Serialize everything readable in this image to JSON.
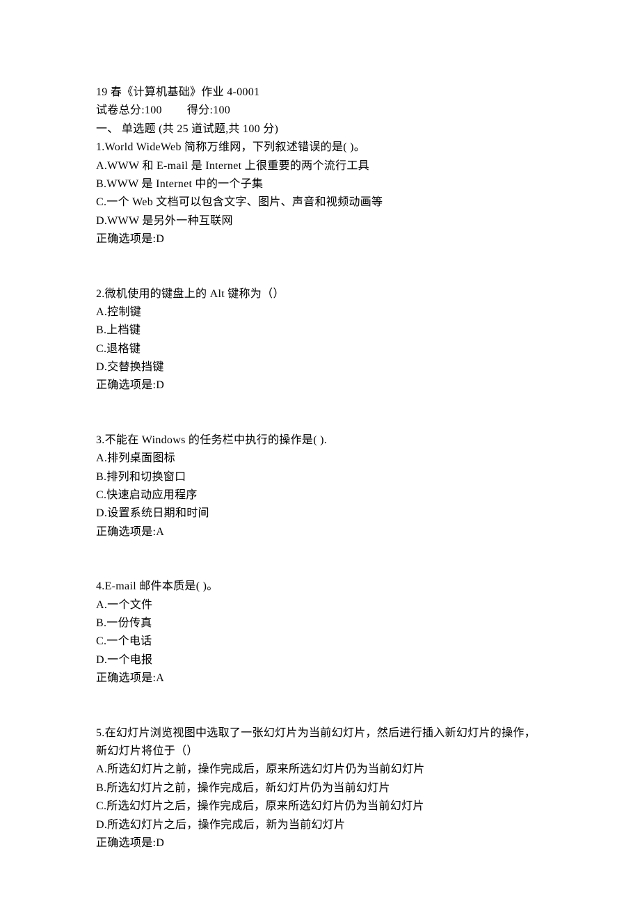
{
  "header": {
    "title": "19 春《计算机基础》作业 4-0001",
    "total_score_label": "试卷总分:100",
    "earned_score_label": "得分:100"
  },
  "section": {
    "label": "一、 单选题 (共 25 道试题,共 100 分)"
  },
  "questions": [
    {
      "number": "1.",
      "stem": "World WideWeb 简称万维网，下列叙述错误的是( )。",
      "options": [
        "A.WWW 和 E-mail 是 Internet 上很重要的两个流行工具",
        "B.WWW 是 Internet 中的一个子集",
        "C.一个 Web 文档可以包含文字、图片、声音和视频动画等",
        "D.WWW 是另外一种互联网"
      ],
      "answer": "正确选项是:D"
    },
    {
      "number": "2.",
      "stem": "微机使用的键盘上的 Alt 键称为（）",
      "options": [
        "A.控制键",
        "B.上档键",
        "C.退格键",
        "D.交替换挡键"
      ],
      "answer": "正确选项是:D"
    },
    {
      "number": "3.",
      "stem": "不能在 Windows 的任务栏中执行的操作是( ).",
      "options": [
        "A.排列桌面图标",
        "B.排列和切换窗口",
        "C.快速启动应用程序",
        "D.设置系统日期和时间"
      ],
      "answer": "正确选项是:A"
    },
    {
      "number": "4.",
      "stem": "E-mail 邮件本质是( )。",
      "options": [
        "A.一个文件",
        "B.一份传真",
        "C.一个电话",
        "D.一个电报"
      ],
      "answer": "正确选项是:A"
    },
    {
      "number": "5.",
      "stem": "在幻灯片浏览视图中选取了一张幻灯片为当前幻灯片，然后进行插入新幻灯片的操作，新幻灯片将位于（）",
      "options": [
        "A.所选幻灯片之前，操作完成后，原来所选幻灯片仍为当前幻灯片",
        "B.所选幻灯片之前，操作完成后，新幻灯片仍为当前幻灯片",
        "C.所选幻灯片之后，操作完成后，原来所选幻灯片仍为当前幻灯片",
        "D.所选幻灯片之后，操作完成后，新为当前幻灯片"
      ],
      "answer": "正确选项是:D"
    }
  ]
}
